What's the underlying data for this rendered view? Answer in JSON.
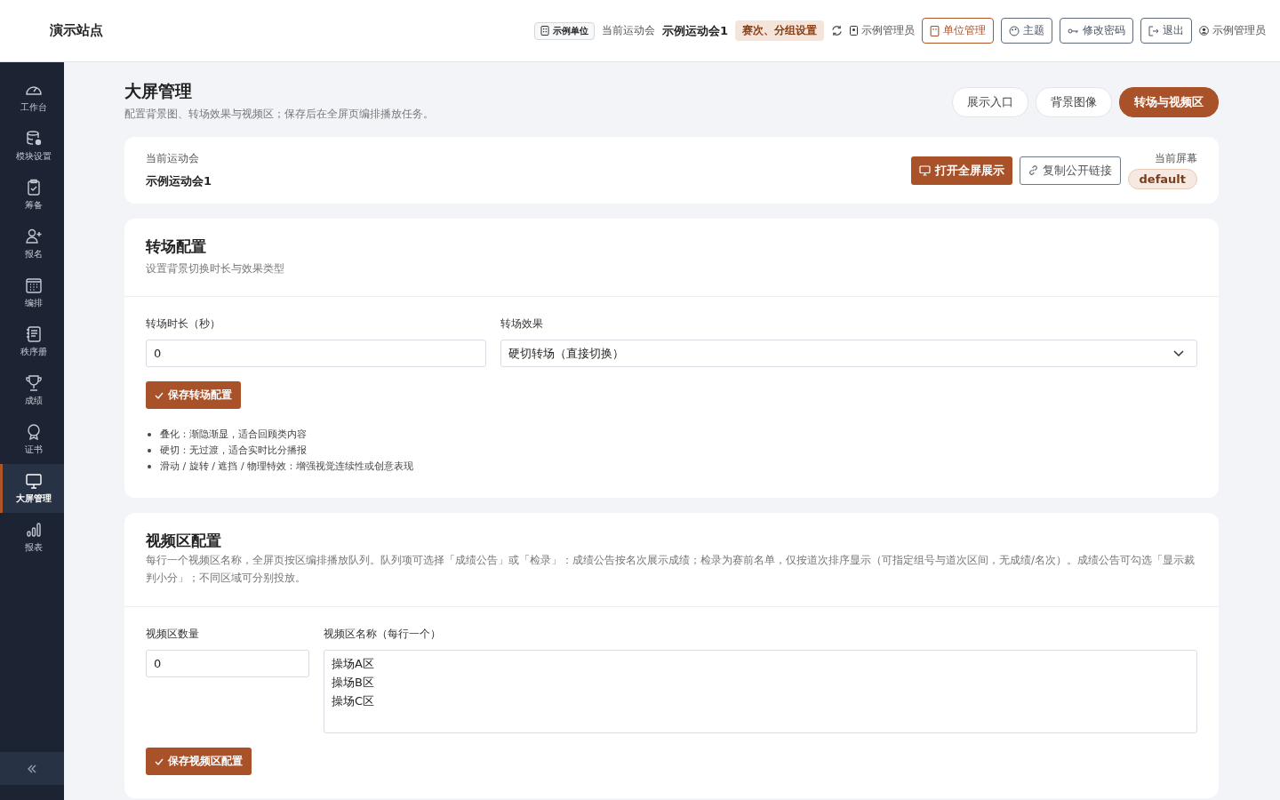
{
  "header": {
    "site_title": "演示站点",
    "unit_badge": "示例单位",
    "meet_label": "当前运动会",
    "meet_name": "示例运动会1",
    "settings_tag": "赛次、分组设置",
    "admin_role": "示例管理员",
    "buttons": [
      {
        "label": "单位管理",
        "kind": "primary"
      },
      {
        "label": "主题",
        "kind": "outline"
      },
      {
        "label": "修改密码",
        "kind": "outline"
      },
      {
        "label": "退出",
        "kind": "outline"
      }
    ],
    "user": "示例管理员"
  },
  "sidebar": {
    "items": [
      {
        "label": "工作台",
        "selected": false
      },
      {
        "label": "模块设置",
        "selected": false
      },
      {
        "label": "筹备",
        "selected": false
      },
      {
        "label": "报名",
        "selected": false
      },
      {
        "label": "编排",
        "selected": false
      },
      {
        "label": "秩序册",
        "selected": false
      },
      {
        "label": "成绩",
        "selected": false
      },
      {
        "label": "证书",
        "selected": false
      },
      {
        "label": "大屏管理",
        "selected": true
      },
      {
        "label": "报表",
        "selected": false
      }
    ]
  },
  "page": {
    "title": "大屏管理",
    "subtitle": "配置背景图、转场效果与视频区；保存后在全屏页编排播放任务。",
    "tabs": [
      {
        "label": "展示入口",
        "selected": false
      },
      {
        "label": "背景图像",
        "selected": false
      },
      {
        "label": "转场与视频区",
        "selected": true
      }
    ]
  },
  "meet_card": {
    "label": "当前运动会",
    "value": "示例运动会1",
    "open_button": "打开全屏展示",
    "copy_button": "复制公开链接",
    "screen_label": "当前屏幕",
    "screen_value": "default"
  },
  "transition": {
    "title": "转场配置",
    "subtitle": "设置背景切换时长与效果类型",
    "duration_label": "转场时长（秒）",
    "duration_value": "0",
    "effect_label": "转场效果",
    "effect_value": "硬切转场（直接切换）",
    "save_button": "保存转场配置",
    "notes": [
      "叠化：渐隐渐显，适合回顾类内容",
      "硬切：无过渡，适合实时比分播报",
      "滑动 / 旋转 / 遮挡 / 物理特效：增强视觉连续性或创意表现"
    ]
  },
  "video": {
    "title": "视频区配置",
    "description": "每行一个视频区名称，全屏页按区编排播放队列。队列项可选择「成绩公告」或「检录」：成绩公告按名次展示成绩；检录为赛前名单，仅按道次排序显示（可指定组号与道次区间，无成绩/名次）。成绩公告可勾选「显示裁判小分」；不同区域可分别投放。",
    "count_label": "视频区数量",
    "count_value": "0",
    "names_label": "视频区名称（每行一个）",
    "names_lines": [
      "操场A区",
      "操场B区",
      "操场C区"
    ],
    "save_button": "保存视频区配置"
  }
}
